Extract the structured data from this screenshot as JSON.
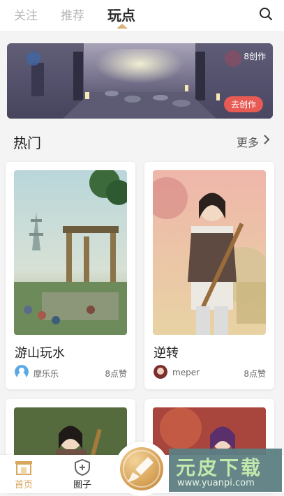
{
  "tabs": [
    {
      "label": "关注"
    },
    {
      "label": "推荐"
    },
    {
      "label": "玩点"
    }
  ],
  "banner": {
    "count": "8创作",
    "cta": "去创作"
  },
  "section": {
    "title": "热门",
    "more": "更多"
  },
  "cards": [
    {
      "title": "游山玩水",
      "author": "摩乐乐",
      "likes": "8点赞"
    },
    {
      "title": "逆转",
      "author": "meper",
      "likes": "8点赞"
    }
  ],
  "bottom_nav": {
    "items": [
      {
        "label": "首页",
        "icon": "home-icon"
      },
      {
        "label": "圈子",
        "icon": "circle-shield-icon"
      }
    ],
    "center": {
      "icon": "brush-icon"
    }
  },
  "watermark": {
    "main": "元皮下载",
    "sub": "www.yuanpi.com"
  },
  "colors": {
    "accent_gold": "#d7a85c",
    "banner_button": "#e85b55"
  }
}
